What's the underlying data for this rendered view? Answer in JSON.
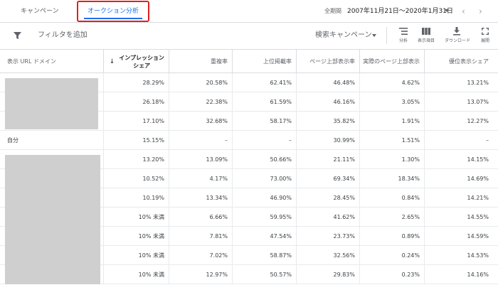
{
  "tabs": {
    "campaign": "キャンペーン",
    "auction": "オークション分析"
  },
  "date": {
    "label": "全期間",
    "range": "2007年11月21日～2020年1月31日"
  },
  "toolbar": {
    "filter_label": "フィルタを追加",
    "search_campaign": "検索キャンペーン",
    "segment": "分析",
    "columns": "表示項目",
    "download": "ダウンロード",
    "expand": "展開"
  },
  "table": {
    "headers": {
      "domain": "表示 URL ドメイン",
      "impression_share_1": "インプレッション",
      "impression_share_2": "シェア",
      "overlap": "重複率",
      "position_above": "上位掲載率",
      "top_of_page": "ページ上部表示率",
      "abs_top": "実際のページ上部表示",
      "outranking": "優位表示シェア"
    },
    "rows": [
      {
        "domain": "",
        "c1": "28.29%",
        "c2": "20.58%",
        "c3": "62.41%",
        "c4": "46.48%",
        "c5": "4.62%",
        "c6": "13.21%"
      },
      {
        "domain": "",
        "c1": "26.18%",
        "c2": "22.38%",
        "c3": "61.59%",
        "c4": "46.16%",
        "c5": "3.05%",
        "c6": "13.07%"
      },
      {
        "domain": "",
        "c1": "17.10%",
        "c2": "32.68%",
        "c3": "58.17%",
        "c4": "35.82%",
        "c5": "1.91%",
        "c6": "12.27%"
      },
      {
        "domain": "自分",
        "c1": "15.15%",
        "c2": "–",
        "c3": "–",
        "c4": "30.99%",
        "c5": "1.51%",
        "c6": "–"
      },
      {
        "domain": "",
        "c1": "13.20%",
        "c2": "13.09%",
        "c3": "50.66%",
        "c4": "21.11%",
        "c5": "1.30%",
        "c6": "14.15%"
      },
      {
        "domain": "",
        "c1": "10.52%",
        "c2": "4.17%",
        "c3": "73.00%",
        "c4": "69.34%",
        "c5": "18.34%",
        "c6": "14.69%"
      },
      {
        "domain": "",
        "c1": "10.19%",
        "c2": "13.34%",
        "c3": "46.90%",
        "c4": "28.45%",
        "c5": "0.84%",
        "c6": "14.21%"
      },
      {
        "domain": "",
        "c1": "10% 未満",
        "c2": "6.66%",
        "c3": "59.95%",
        "c4": "41.62%",
        "c5": "2.65%",
        "c6": "14.55%"
      },
      {
        "domain": "",
        "c1": "10% 未満",
        "c2": "7.81%",
        "c3": "47.54%",
        "c4": "23.73%",
        "c5": "0.89%",
        "c6": "14.59%"
      },
      {
        "domain": "",
        "c1": "10% 未満",
        "c2": "7.02%",
        "c3": "58.87%",
        "c4": "32.56%",
        "c5": "0.24%",
        "c6": "14.53%"
      },
      {
        "domain": "",
        "c1": "10% 未満",
        "c2": "12.97%",
        "c3": "50.57%",
        "c4": "29.83%",
        "c5": "0.23%",
        "c6": "14.16%"
      }
    ]
  },
  "colors": {
    "accent": "#1a73e8",
    "highlight_box": "#e02020",
    "redaction": "#cfcfcf"
  }
}
